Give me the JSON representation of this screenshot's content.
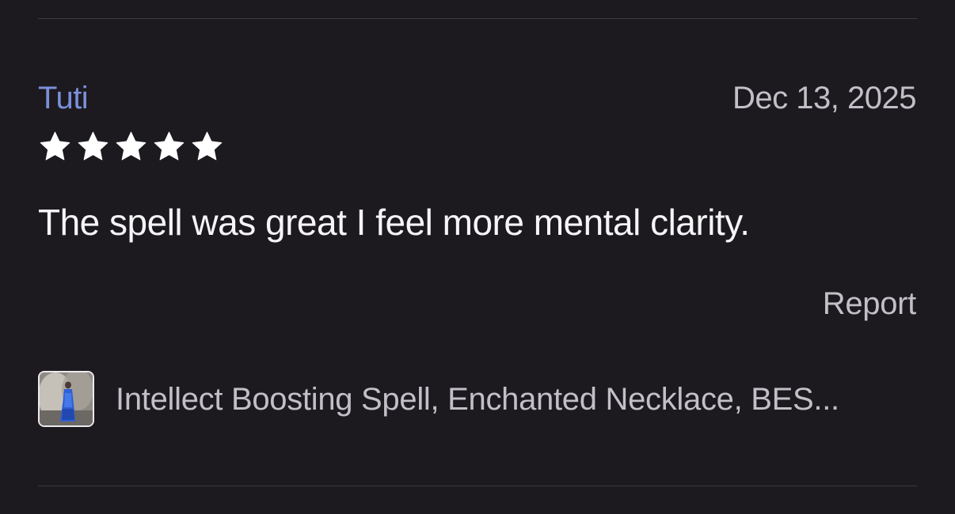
{
  "review": {
    "reviewer_name": "Tuti",
    "date": "Dec 13, 2025",
    "rating": 5,
    "rating_max": 5,
    "text": "The spell was great I feel more mental clarity.",
    "report_label": "Report",
    "product": {
      "name": "Intellect Boosting Spell, Enchanted Necklace, BES...",
      "thumbnail_icon": "product-thumbnail"
    }
  },
  "colors": {
    "background": "#1c1a1e",
    "reviewer_name": "#7b8fdc",
    "primary_text": "#f5f4f6",
    "secondary_text": "#c2bfc6",
    "star": "#ffffff",
    "divider": "#3c3a3f"
  }
}
